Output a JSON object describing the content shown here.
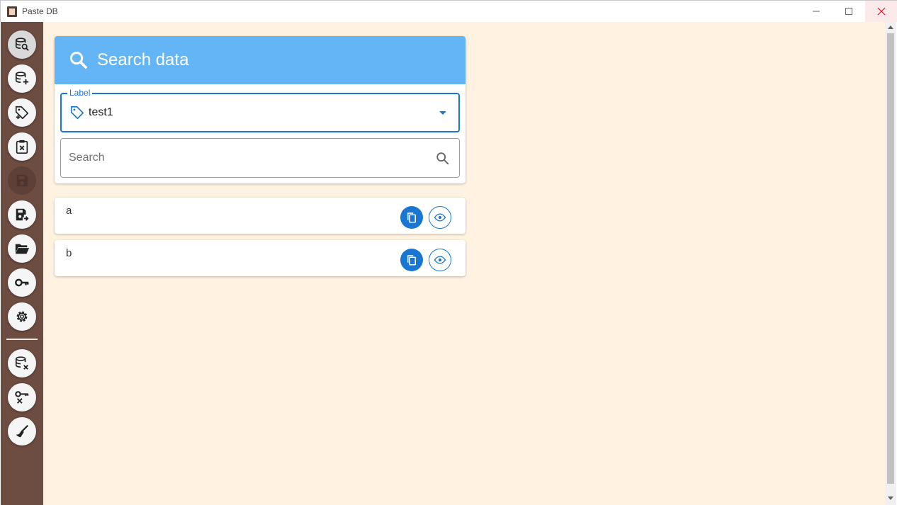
{
  "window": {
    "title": "Paste DB",
    "minimize": "—",
    "maximize": "☐",
    "close": "✕"
  },
  "sidebar": {
    "items": [
      {
        "name": "search-database",
        "icon": "database-search-icon",
        "state": "active"
      },
      {
        "name": "add-database",
        "icon": "database-plus-icon",
        "state": "normal"
      },
      {
        "name": "add-label",
        "icon": "tag-plus-icon",
        "state": "normal"
      },
      {
        "name": "clear-clipboard",
        "icon": "clipboard-remove-icon",
        "state": "normal"
      },
      {
        "name": "save",
        "icon": "save-icon",
        "state": "disabled"
      },
      {
        "name": "save-as",
        "icon": "save-export-icon",
        "state": "normal"
      },
      {
        "name": "open",
        "icon": "folder-open-icon",
        "state": "normal"
      },
      {
        "name": "key",
        "icon": "key-icon",
        "state": "normal"
      },
      {
        "name": "settings",
        "icon": "gear-icon",
        "state": "normal"
      },
      {
        "name": "delete-database",
        "icon": "database-remove-icon",
        "state": "normal"
      },
      {
        "name": "delete-key",
        "icon": "key-remove-icon",
        "state": "normal"
      },
      {
        "name": "clean",
        "icon": "broom-icon",
        "state": "normal"
      }
    ]
  },
  "search_panel": {
    "title": "Search data",
    "label_field": {
      "legend": "Label",
      "value": "test1"
    },
    "search_field": {
      "placeholder": "Search",
      "value": ""
    }
  },
  "results": [
    {
      "text": "a"
    },
    {
      "text": "b"
    }
  ],
  "colors": {
    "sidebar": "#6d4c41",
    "background": "#fff2e1",
    "header": "#64b5f6",
    "accent": "#1976d2"
  }
}
